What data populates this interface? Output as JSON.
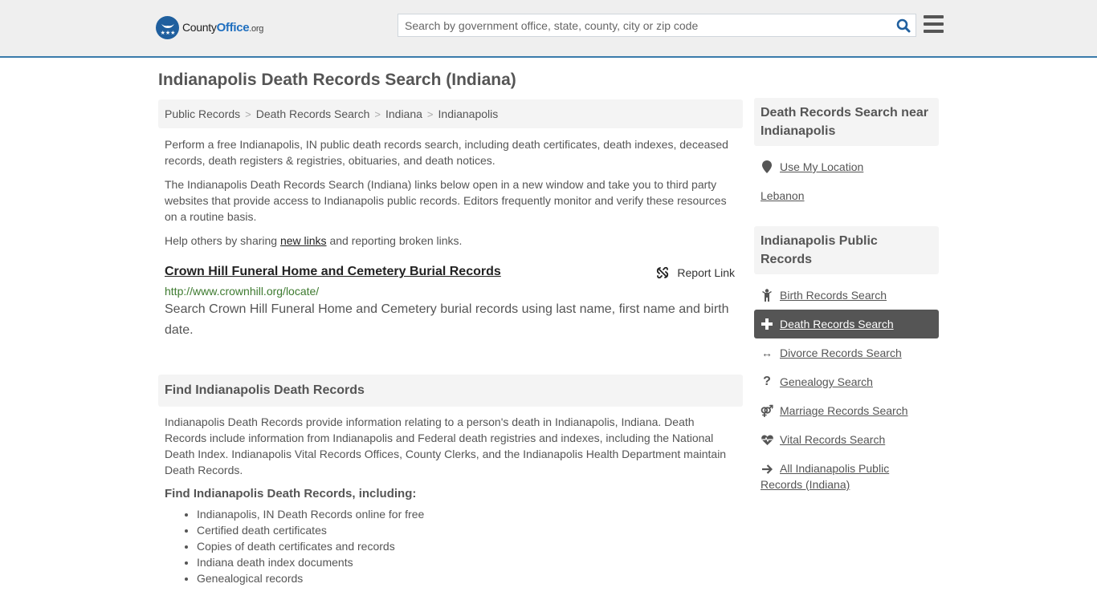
{
  "header": {
    "logo_prefix": "County",
    "logo_bold": "Office",
    "logo_suffix": ".org",
    "search_placeholder": "Search by government office, state, county, city or zip code",
    "search_icon": "search-icon",
    "menu_icon": "hamburger-menu-icon"
  },
  "page": {
    "title": "Indianapolis Death Records Search (Indiana)"
  },
  "breadcrumb": [
    {
      "label": "Public Records"
    },
    {
      "label": "Death Records Search"
    },
    {
      "label": "Indiana"
    },
    {
      "label": "Indianapolis"
    }
  ],
  "intro": {
    "p1": "Perform a free Indianapolis, IN public death records search, including death certificates, death indexes, deceased records, death registers & registries, obituaries, and death notices.",
    "p2": "The Indianapolis Death Records Search (Indiana) links below open in a new window and take you to third party websites that provide access to Indianapolis public records. Editors frequently monitor and verify these resources on a routine basis.",
    "p3_before": "Help others by sharing ",
    "p3_link": "new links",
    "p3_after": " and reporting broken links."
  },
  "results": [
    {
      "title": "Crown Hill Funeral Home and Cemetery Burial Records",
      "url": "http://www.crownhill.org/locate/",
      "description": "Search Crown Hill Funeral Home and Cemetery burial records using last name, first name and birth date.",
      "report_label": "Report Link"
    }
  ],
  "find_section": {
    "heading": "Find Indianapolis Death Records",
    "body": "Indianapolis Death Records provide information relating to a person's death in Indianapolis, Indiana. Death Records include information from Indianapolis and Federal death registries and indexes, including the National Death Index. Indianapolis Vital Records Offices, County Clerks, and the Indianapolis Health Department maintain Death Records.",
    "subheading": "Find Indianapolis Death Records, including:",
    "items": [
      "Indianapolis, IN Death Records online for free",
      "Certified death certificates",
      "Copies of death certificates and records",
      "Indiana death index documents",
      "Genealogical records"
    ]
  },
  "sidebar": {
    "nearby": {
      "heading": "Death Records Search near Indianapolis",
      "use_location": "Use My Location",
      "places": [
        "Lebanon"
      ]
    },
    "public_records": {
      "heading": "Indianapolis Public Records",
      "links": [
        {
          "label": "Birth Records Search",
          "icon": "child-icon",
          "active": false
        },
        {
          "label": "Death Records Search",
          "icon": "plus-icon",
          "active": true
        },
        {
          "label": "Divorce Records Search",
          "icon": "arrows-horizontal-icon",
          "active": false
        },
        {
          "label": "Genealogy Search",
          "icon": "question-icon",
          "active": false
        },
        {
          "label": "Marriage Records Search",
          "icon": "venus-mars-icon",
          "active": false
        },
        {
          "label": "Vital Records Search",
          "icon": "heartbeat-icon",
          "active": false
        },
        {
          "label": "All Indianapolis Public Records (Indiana)",
          "icon": "arrow-right-icon",
          "active": false
        }
      ]
    }
  },
  "colors": {
    "brand_blue": "#1f5f9e",
    "header_border": "#3a7bab",
    "url_green": "#3d7a2f",
    "active_bg": "#555555"
  }
}
